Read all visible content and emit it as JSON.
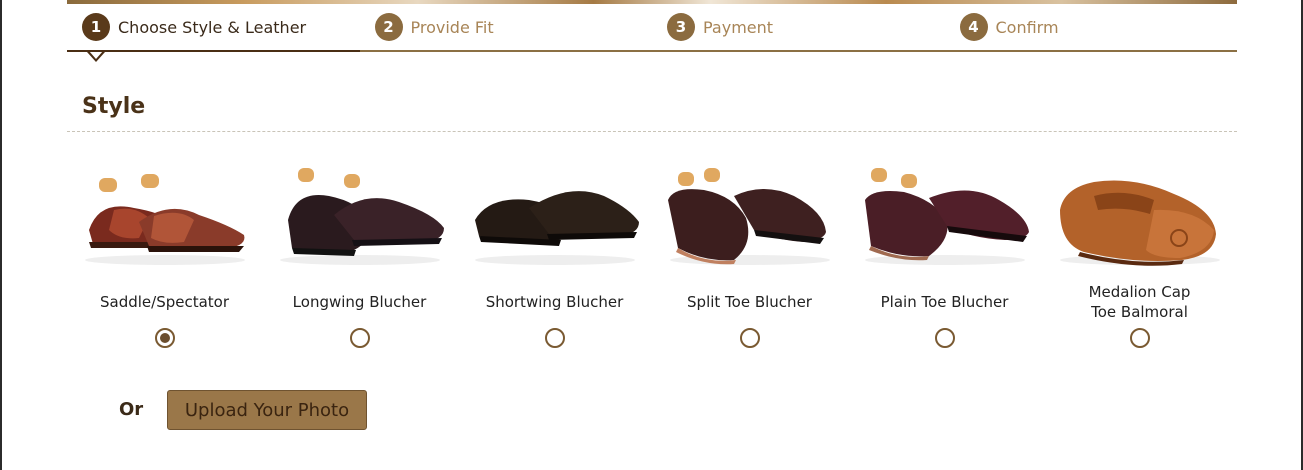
{
  "steps": [
    {
      "num": "1",
      "label": "Choose Style & Leather",
      "active": true
    },
    {
      "num": "2",
      "label": "Provide Fit",
      "active": false
    },
    {
      "num": "3",
      "label": "Payment",
      "active": false
    },
    {
      "num": "4",
      "label": "Confirm",
      "active": false
    }
  ],
  "section": {
    "title": "Style"
  },
  "styles": [
    {
      "name": "Saddle/Spectator",
      "selected": true
    },
    {
      "name": "Longwing Blucher",
      "selected": false
    },
    {
      "name": "Shortwing Blucher",
      "selected": false
    },
    {
      "name": "Split Toe Blucher",
      "selected": false
    },
    {
      "name": "Plain Toe Blucher",
      "selected": false
    },
    {
      "name": "Medalion Cap Toe Balmoral",
      "selected": false
    }
  ],
  "upload": {
    "or_label": "Or",
    "button_label": "Upload Your Photo"
  },
  "colors": {
    "accent": "#8b6b3f",
    "active_step": "#5a3a1a",
    "button": "#9a7749"
  }
}
